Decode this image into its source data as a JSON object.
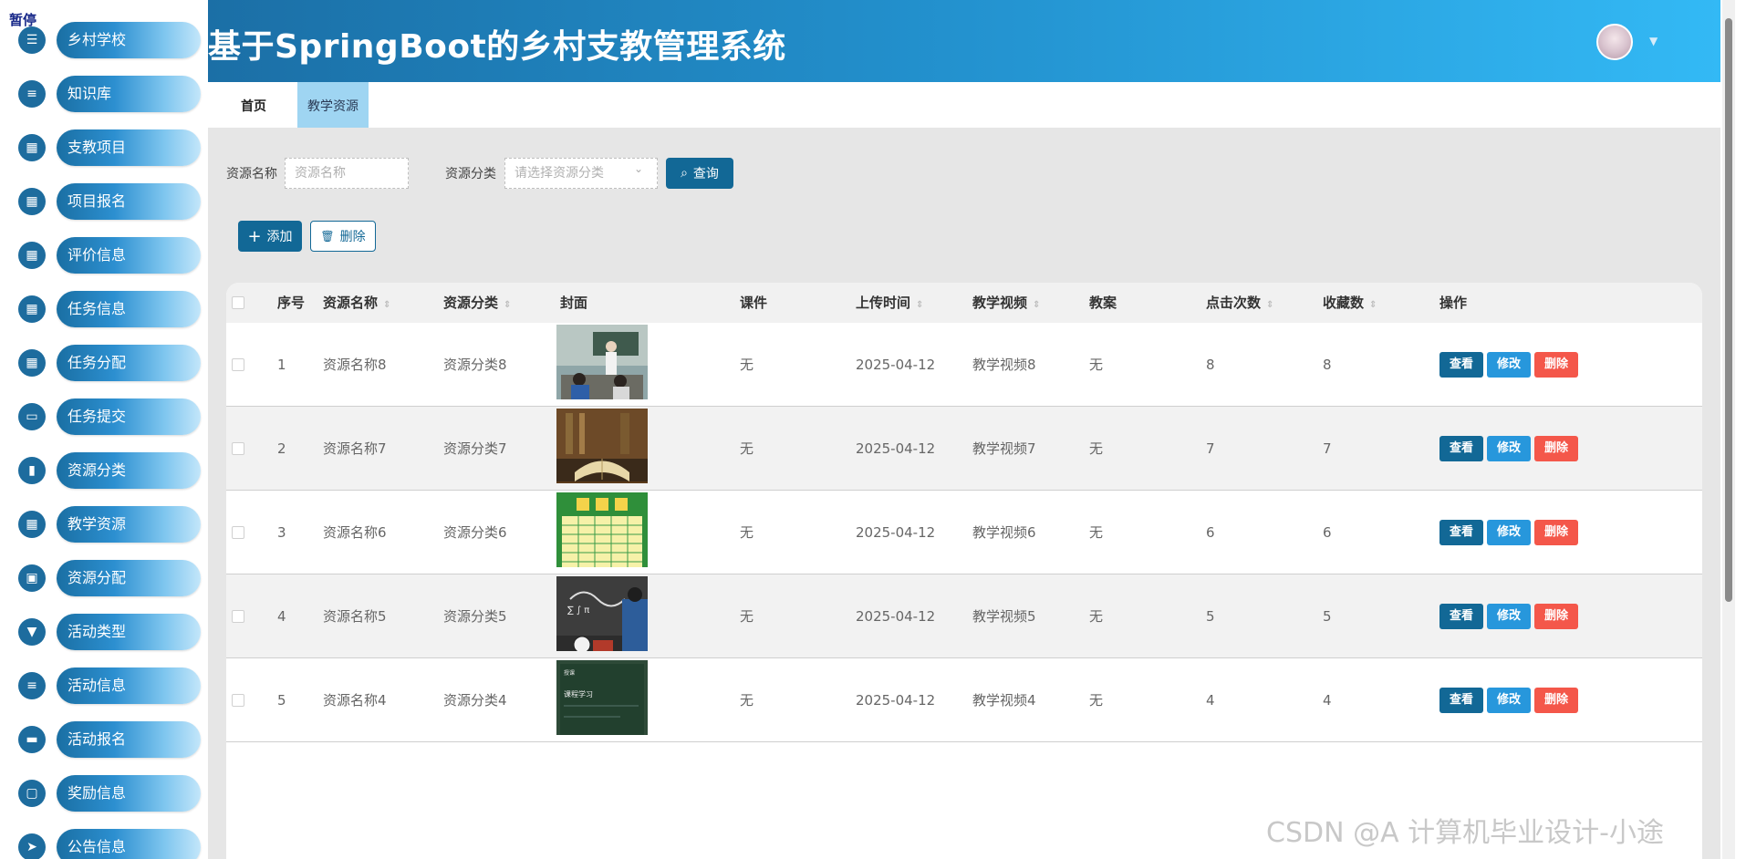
{
  "sidebar": {
    "pause_tag": "暂停",
    "items": [
      {
        "label": "乡村学校",
        "icon": "sliders-icon",
        "glyph": "☰"
      },
      {
        "label": "知识库",
        "icon": "list-icon",
        "glyph": "≡"
      },
      {
        "label": "支教项目",
        "icon": "grid-icon",
        "glyph": "▦"
      },
      {
        "label": "项目报名",
        "icon": "grid-icon",
        "glyph": "▦"
      },
      {
        "label": "评价信息",
        "icon": "grid-icon",
        "glyph": "▦"
      },
      {
        "label": "任务信息",
        "icon": "grid-icon",
        "glyph": "▦"
      },
      {
        "label": "任务分配",
        "icon": "grid-icon",
        "glyph": "▦"
      },
      {
        "label": "任务提交",
        "icon": "stamp-icon",
        "glyph": "▭"
      },
      {
        "label": "资源分类",
        "icon": "bar-chart-icon",
        "glyph": "▮"
      },
      {
        "label": "教学资源",
        "icon": "grid-icon",
        "glyph": "▦"
      },
      {
        "label": "资源分配",
        "icon": "calendar-icon",
        "glyph": "▣"
      },
      {
        "label": "活动类型",
        "icon": "flag-icon",
        "glyph": "▼"
      },
      {
        "label": "活动信息",
        "icon": "list-icon",
        "glyph": "≡"
      },
      {
        "label": "活动报名",
        "icon": "ticket-icon",
        "glyph": "▬"
      },
      {
        "label": "奖励信息",
        "icon": "monitor-icon",
        "glyph": "▢"
      },
      {
        "label": "公告信息",
        "icon": "send-icon",
        "glyph": "➤"
      }
    ]
  },
  "header": {
    "title": "基于SpringBoot的乡村支教管理系统",
    "caret": "▼"
  },
  "tabs": {
    "home": "首页",
    "active": "教学资源"
  },
  "search": {
    "name_label": "资源名称",
    "name_placeholder": "资源名称",
    "category_label": "资源分类",
    "category_placeholder": "请选择资源分类",
    "select_caret": "⌄",
    "query_label": "查询",
    "query_icon": "⌕"
  },
  "toolbar": {
    "add_label": "添加",
    "add_icon": "+",
    "delete_label": "删除",
    "delete_icon": "🗑"
  },
  "table": {
    "columns": {
      "index": "序号",
      "name": "资源名称",
      "category": "资源分类",
      "cover": "封面",
      "courseware": "课件",
      "upload_time": "上传时间",
      "video": "教学视频",
      "lesson_plan": "教案",
      "clicks": "点击次数",
      "favorites": "收藏数",
      "actions": "操作"
    },
    "sort_glyph": "⇕",
    "action_labels": {
      "view": "查看",
      "edit": "修改",
      "delete": "删除"
    },
    "rows": [
      {
        "index": "1",
        "name": "资源名称8",
        "category": "资源分类8",
        "courseware": "无",
        "upload_time": "2025-04-12",
        "video": "教学视频8",
        "lesson_plan": "无",
        "clicks": "8",
        "favorites": "8",
        "cover": "classroom-photo"
      },
      {
        "index": "2",
        "name": "资源名称7",
        "category": "资源分类7",
        "courseware": "无",
        "upload_time": "2025-04-12",
        "video": "教学视频7",
        "lesson_plan": "无",
        "clicks": "7",
        "favorites": "7",
        "cover": "open-book-photo"
      },
      {
        "index": "3",
        "name": "资源名称6",
        "category": "资源分类6",
        "courseware": "无",
        "upload_time": "2025-04-12",
        "video": "教学视频6",
        "lesson_plan": "无",
        "clicks": "6",
        "favorites": "6",
        "cover": "timetable-image"
      },
      {
        "index": "4",
        "name": "资源名称5",
        "category": "资源分类5",
        "courseware": "无",
        "upload_time": "2025-04-12",
        "video": "教学视频5",
        "lesson_plan": "无",
        "clicks": "5",
        "favorites": "5",
        "cover": "chalkboard-photo"
      },
      {
        "index": "5",
        "name": "资源名称4",
        "category": "资源分类4",
        "courseware": "无",
        "upload_time": "2025-04-12",
        "video": "教学视频4",
        "lesson_plan": "无",
        "clicks": "4",
        "favorites": "4",
        "cover": "blackboard-lesson-photo"
      }
    ]
  },
  "watermark": "CSDN @A 计算机毕业设计-小途",
  "colors": {
    "primary": "#126896",
    "edit": "#2797dc",
    "danger": "#f4574a",
    "header_start": "#1b6fa6",
    "header_end": "#33b9f5",
    "active_tab": "#9fd5f2"
  }
}
